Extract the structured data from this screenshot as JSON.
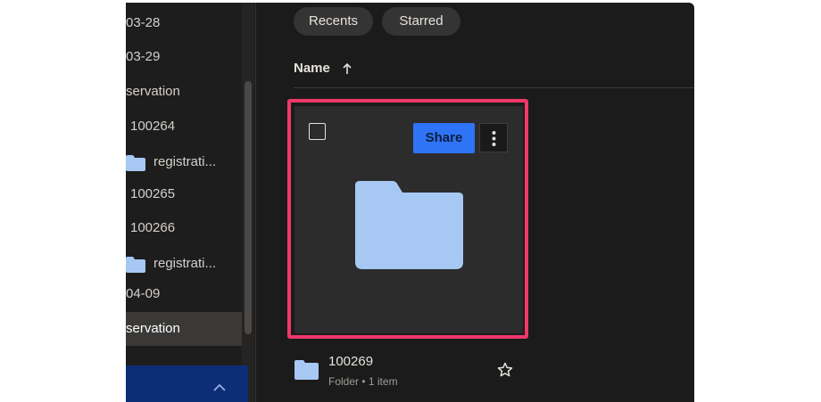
{
  "sidebar": {
    "items": [
      {
        "label": "03-28",
        "has_folder_icon": false
      },
      {
        "label": "03-29",
        "has_folder_icon": false
      },
      {
        "label": "servation",
        "has_folder_icon": false
      },
      {
        "label": "100264",
        "has_folder_icon": false
      },
      {
        "label": "registrati...",
        "has_folder_icon": true
      },
      {
        "label": "100265",
        "has_folder_icon": false
      },
      {
        "label": "100266",
        "has_folder_icon": false
      },
      {
        "label": "registrati...",
        "has_folder_icon": true
      },
      {
        "label": "04-09",
        "has_folder_icon": false
      },
      {
        "label": "servation",
        "has_folder_icon": false,
        "active": true
      }
    ],
    "upload_bar_icon": "chevron-up-icon"
  },
  "filters": {
    "recents_label": "Recents",
    "starred_label": "Starred"
  },
  "list_header": {
    "sort_label": "Name",
    "sort_direction_icon": "arrow-up-icon"
  },
  "card": {
    "share_label": "Share",
    "more_icon": "kebab-menu-icon",
    "highlight_color": "#f0396a"
  },
  "file": {
    "name": "100269",
    "meta": "Folder • 1 item",
    "star_icon": "star-outline-icon"
  },
  "colors": {
    "background": "#1c1b1b",
    "accent_blue": "#2f74f6",
    "folder_blue": "#a6c8f3",
    "upload_bar": "#0d2e77"
  }
}
